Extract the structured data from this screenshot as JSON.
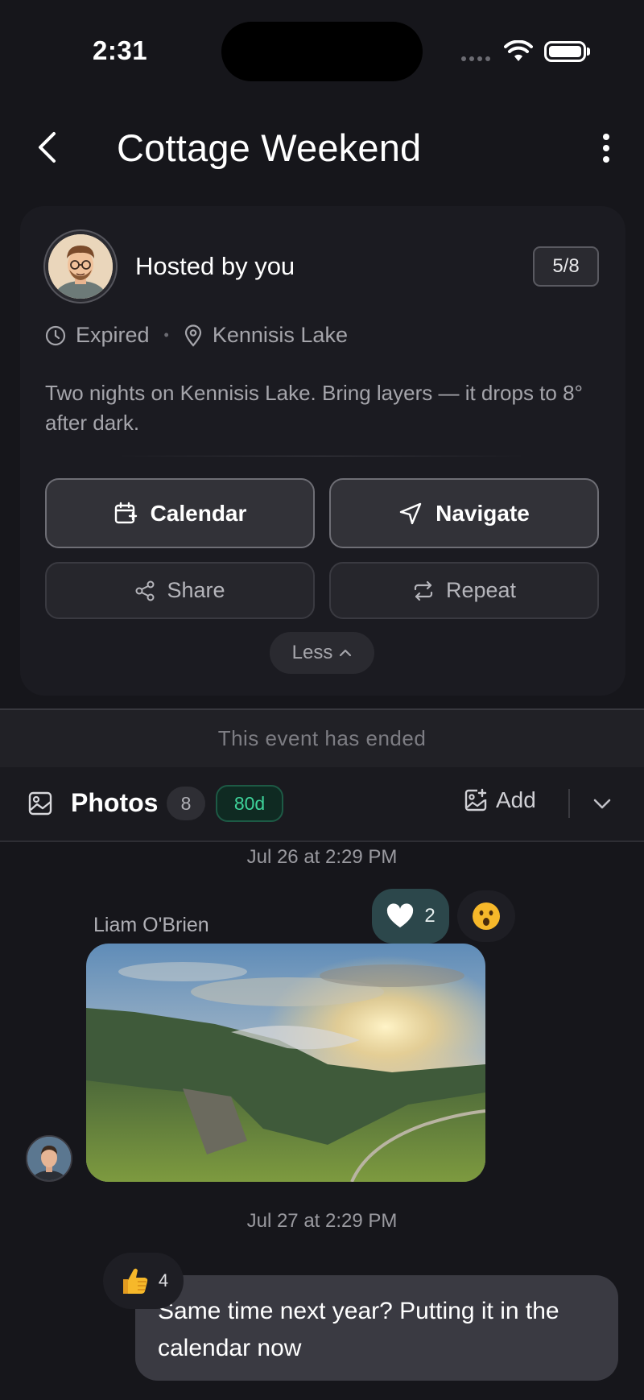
{
  "status_bar": {
    "time": "2:31"
  },
  "header": {
    "title": "Cottage Weekend"
  },
  "event": {
    "host_label": "Hosted by you",
    "attendance": "5/8",
    "status": "Expired",
    "location": "Kennisis Lake",
    "description": "Two nights on Kennisis Lake. Bring layers — it drops to 8° after dark.",
    "buttons": {
      "calendar": "Calendar",
      "navigate": "Navigate",
      "share": "Share",
      "repeat": "Repeat",
      "less": "Less"
    }
  },
  "ended_banner": "This event has ended",
  "photos_bar": {
    "label": "Photos",
    "count": "8",
    "days_left": "80d",
    "add_label": "Add"
  },
  "feed": [
    {
      "timestamp": "Jul 26 at 2:29 PM",
      "sender": "Liam O'Brien",
      "reactions": [
        {
          "icon": "heart-icon",
          "count": "2"
        },
        {
          "icon": "wow-emoji-icon",
          "count": ""
        }
      ]
    },
    {
      "timestamp": "Jul 27 at 2:29 PM",
      "message": "Same time next year? Putting it in the calendar now",
      "reactions": [
        {
          "icon": "thumbs-up-emoji-icon",
          "count": "4"
        }
      ]
    }
  ],
  "colors": {
    "background": "#16161b",
    "card": "#1b1b21",
    "accent_green": "#3ed39a",
    "heart_reaction_bg": "#2c474b"
  }
}
